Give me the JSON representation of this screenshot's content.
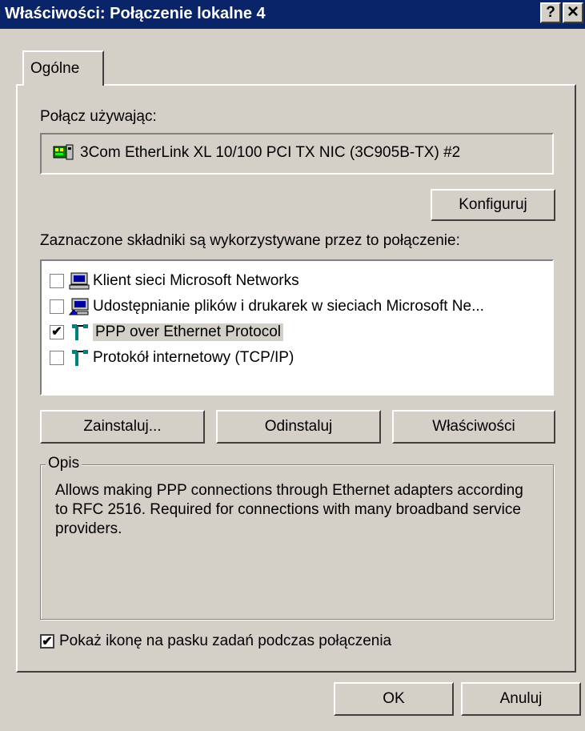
{
  "window": {
    "title": "Właściwości: Połączenie lokalne 4",
    "help_label": "?",
    "close_label": "✕"
  },
  "tabs": [
    {
      "label": "Ogólne"
    }
  ],
  "connect_using": {
    "label": "Połącz używając:",
    "adapter": "3Com EtherLink XL 10/100 PCI TX NIC (3C905B-TX) #2",
    "adapter_icon": "network-card-icon",
    "configure_label": "Konfiguruj"
  },
  "components": {
    "label": "Zaznaczone składniki są wykorzystywane przez to połączenie:",
    "items": [
      {
        "label": "Klient sieci Microsoft Networks",
        "checked": false,
        "icon": "client-computer-icon"
      },
      {
        "label": "Udostępnianie plików i drukarek w sieciach Microsoft Ne...",
        "checked": false,
        "icon": "file-printer-sharing-icon"
      },
      {
        "label": "PPP over Ethernet Protocol",
        "checked": true,
        "icon": "protocol-icon"
      },
      {
        "label": "Protokół internetowy (TCP/IP)",
        "checked": false,
        "icon": "protocol-icon"
      }
    ],
    "install_label": "Zainstaluj...",
    "uninstall_label": "Odinstaluj",
    "properties_label": "Właściwości"
  },
  "description": {
    "label": "Opis",
    "text": "Allows making PPP connections through Ethernet adapters according to RFC 2516. Required for connections with many broadband service providers."
  },
  "show_icon": {
    "label": "Pokaż ikonę na pasku zadań podczas połączenia",
    "checked": true
  },
  "footer": {
    "ok_label": "OK",
    "cancel_label": "Anuluj"
  }
}
